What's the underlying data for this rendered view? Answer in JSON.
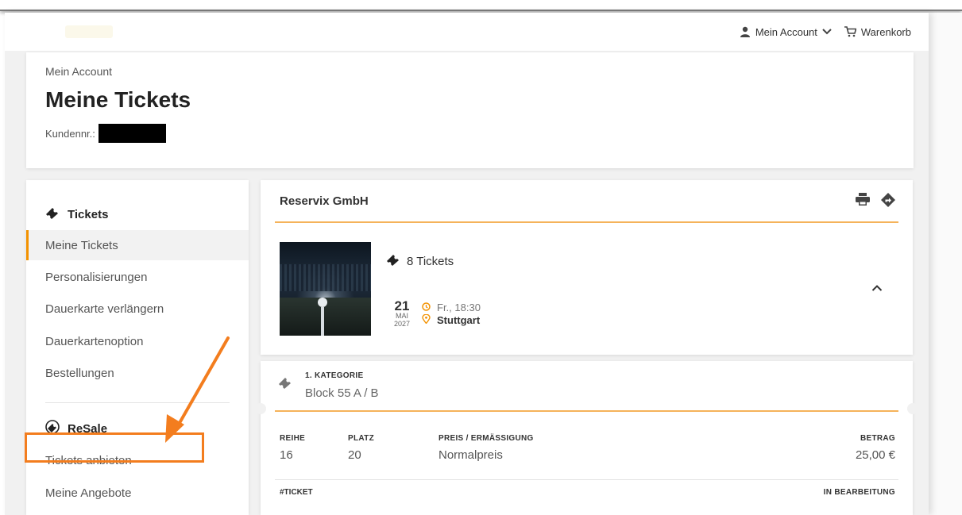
{
  "header": {
    "account_label": "Mein Account",
    "cart_label": "Warenkorb"
  },
  "account": {
    "breadcrumb": "Mein Account",
    "title": "Meine Tickets",
    "customer_label": "Kundennr.:"
  },
  "sidebar": {
    "tickets_title": "Tickets",
    "items": [
      {
        "label": "Meine Tickets",
        "active": true
      },
      {
        "label": "Personalisierungen"
      },
      {
        "label": "Dauerkarte verlängern"
      },
      {
        "label": "Dauerkartenoption"
      },
      {
        "label": "Bestellungen"
      }
    ],
    "resale_title": "ReSale",
    "resale_items": [
      {
        "label": "Tickets anbieten",
        "highlighted": true
      },
      {
        "label": "Meine Angebote"
      }
    ]
  },
  "event": {
    "organizer": "Reservix GmbH",
    "tickets_count": "8 Tickets",
    "day": "21",
    "month": "MAI",
    "year": "2027",
    "time": "Fr., 18:30",
    "city": "Stuttgart"
  },
  "ticket": {
    "category": "1. KATEGORIE",
    "block": "Block 55 A / B",
    "headers": {
      "row": "REIHE",
      "seat": "PLATZ",
      "price": "PREIS / ERMÄSSIGUNG",
      "amount": "BETRAG"
    },
    "row": "16",
    "seat": "20",
    "price": "Normalpreis",
    "amount": "25,00 €",
    "ticket_no_label": "#TICKET",
    "status": "IN BEARBEITUNG"
  },
  "colors": {
    "accent": "#f39200",
    "annotation": "#f37d1e"
  }
}
